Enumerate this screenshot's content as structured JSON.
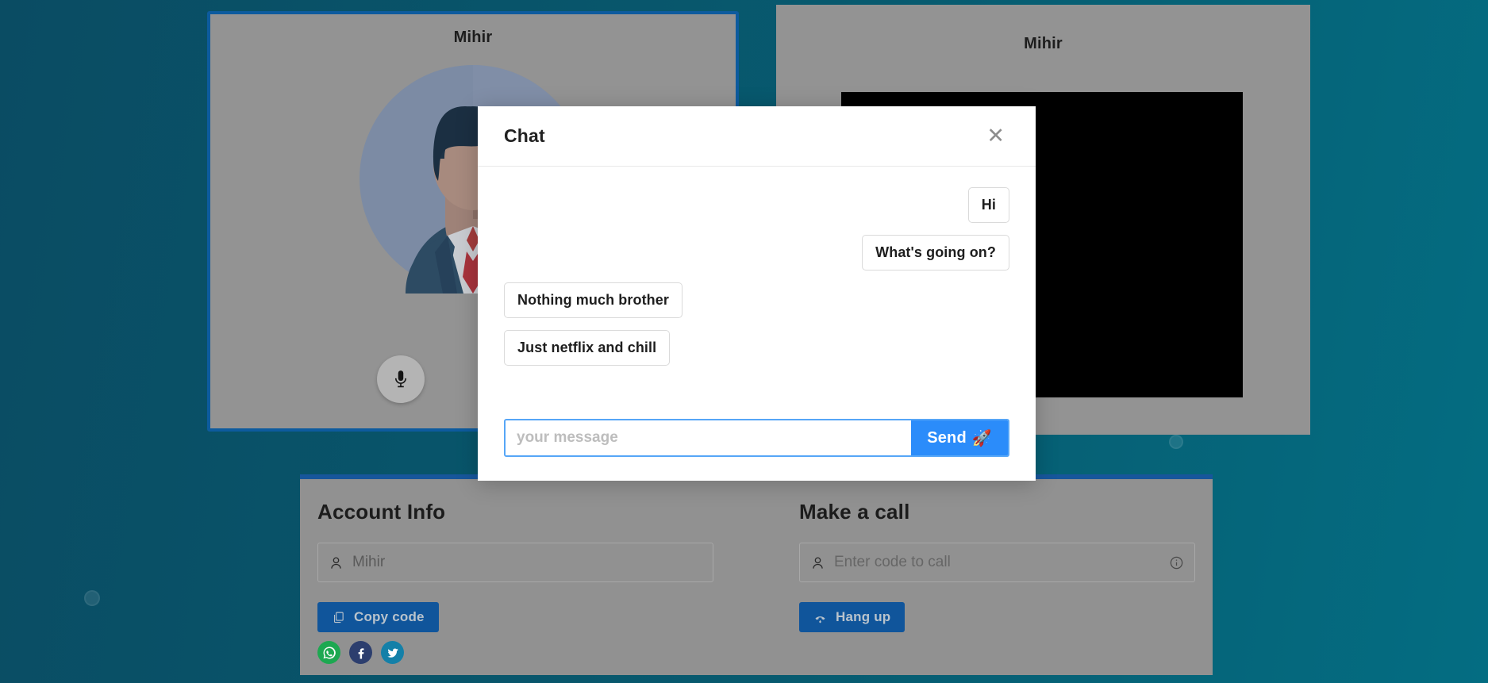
{
  "background": {
    "color_left": "#0a4c63",
    "color_right": "#046d82"
  },
  "tiles": {
    "local": {
      "name": "Mihir",
      "border_color": "#0d5b9e"
    },
    "remote": {
      "name": "Mihir"
    }
  },
  "controls": [
    {
      "name": "microphone-button",
      "icon": "microphone-icon"
    },
    {
      "name": "chat-button",
      "icon": "chat-bubble-icon"
    }
  ],
  "chat_modal": {
    "title": "Chat",
    "close_label": "✕",
    "messages": [
      {
        "text": "Hi",
        "side": "out"
      },
      {
        "text": "What's going on?",
        "side": "out"
      },
      {
        "text": "Nothing much brother",
        "side": "in"
      },
      {
        "text": "Just netflix and chill",
        "side": "in"
      }
    ],
    "input": {
      "value": "",
      "placeholder": "your message"
    },
    "send_label": "Send",
    "send_icon": "🚀",
    "send_color": "#2b8cfa",
    "focus_ring_color": "#56a6f7"
  },
  "account_info": {
    "title": "Account Info",
    "username_field": {
      "value": "Mihir",
      "icon": "user-icon"
    },
    "copy_button": {
      "label": "Copy code",
      "icon": "copy-icon",
      "color": "#10559b"
    },
    "social": [
      {
        "name": "whatsapp",
        "color": "#1da851"
      },
      {
        "name": "facebook",
        "color": "#2c3e6e"
      },
      {
        "name": "twitter",
        "color": "#1480a8"
      }
    ]
  },
  "make_a_call": {
    "title": "Make a call",
    "code_field": {
      "value": "",
      "placeholder": "Enter code to call",
      "icon": "user-icon",
      "info_icon": "info-icon"
    },
    "hangup_button": {
      "label": "Hang up",
      "icon": "phone-down-icon",
      "color": "#10559b"
    }
  }
}
